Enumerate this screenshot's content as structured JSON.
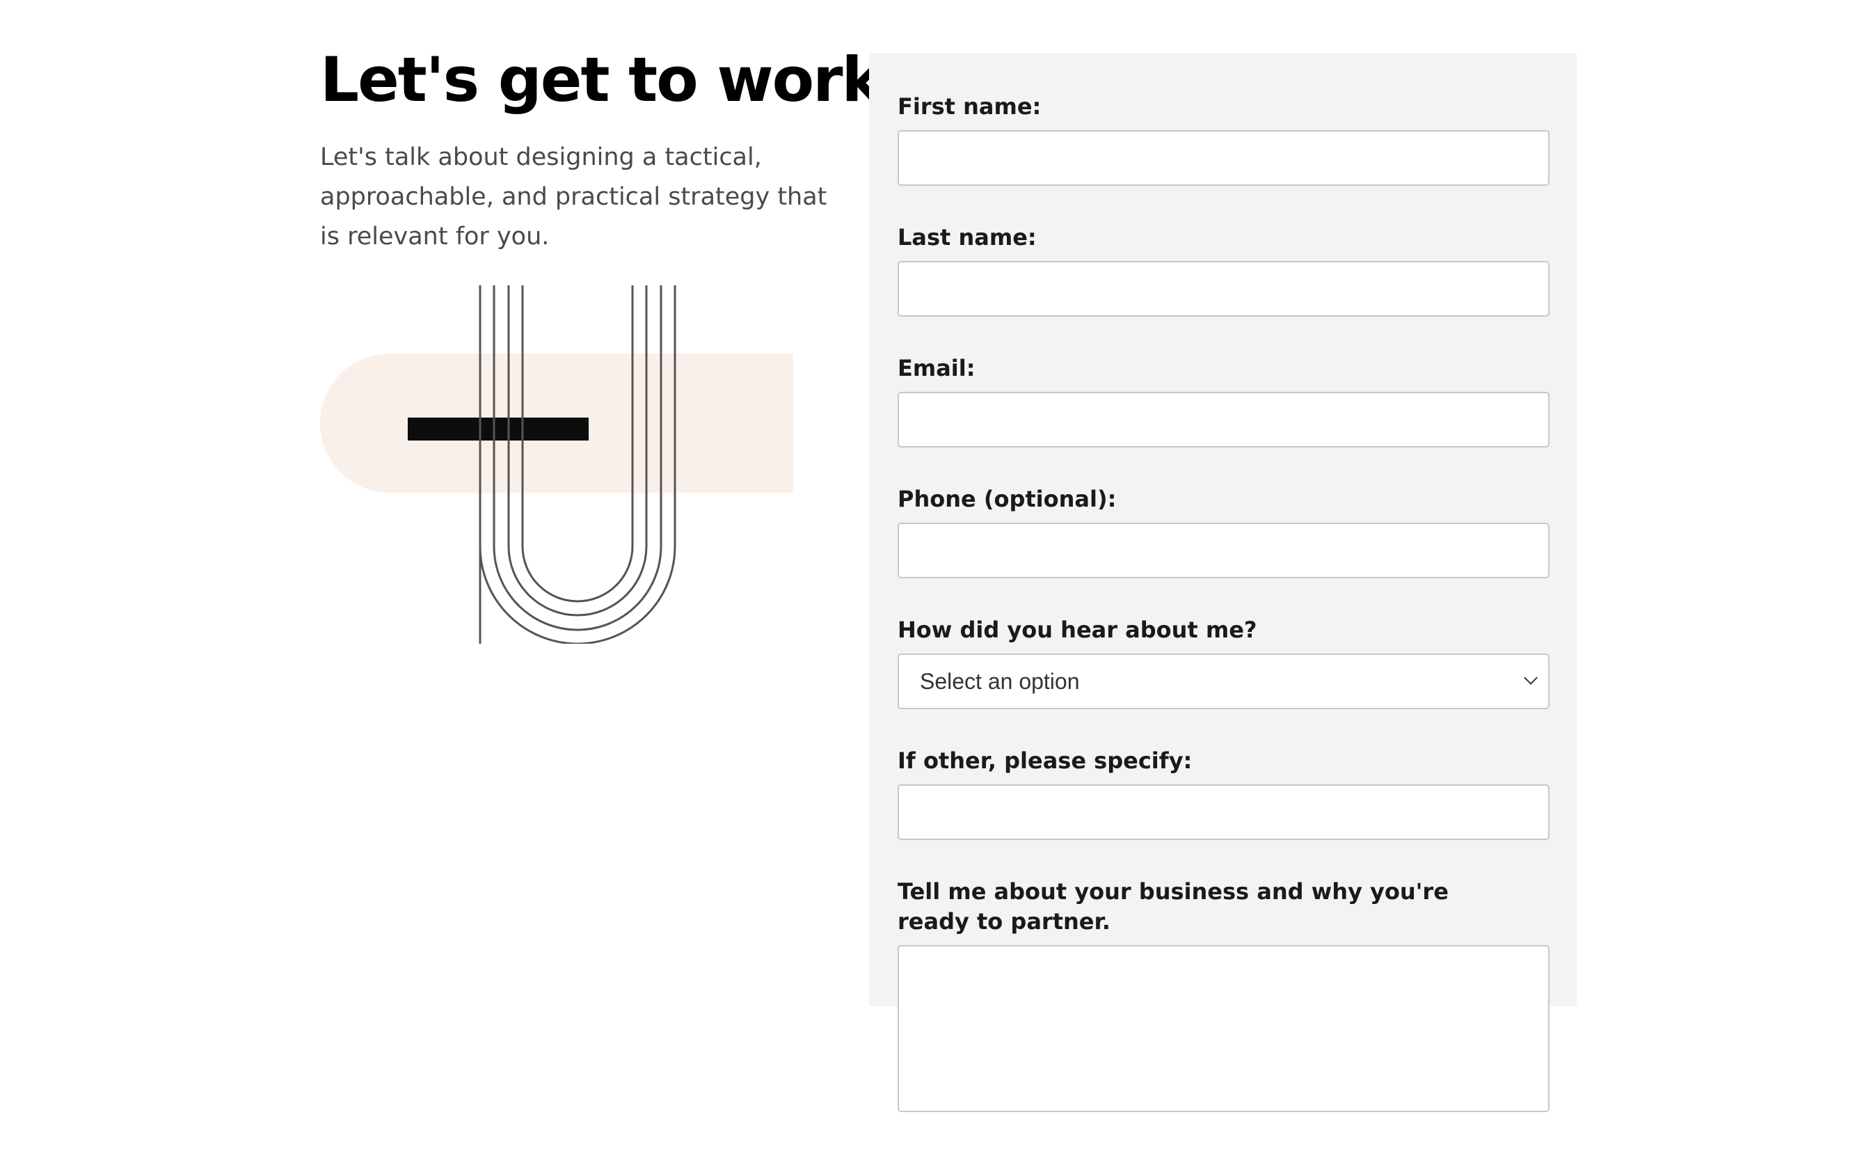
{
  "hero": {
    "title": "Let's get to work!",
    "intro": "Let's talk about designing a tactical, approachable, and practical strategy that is relevant for you."
  },
  "illustration": {
    "icon": "abstract-arches-illustration",
    "accent_color": "#faf0ea",
    "bar_color": "#0d0d0d",
    "line_color": "#555555"
  },
  "form": {
    "first_name": {
      "label": "First name:",
      "value": ""
    },
    "last_name": {
      "label": "Last name:",
      "value": ""
    },
    "email": {
      "label": "Email:",
      "value": ""
    },
    "phone": {
      "label": "Phone (optional):",
      "value": ""
    },
    "source": {
      "label": "How did you hear about me?",
      "selected": "Select an option"
    },
    "other": {
      "label": "If other, please specify:",
      "value": ""
    },
    "message": {
      "label": "Tell me about your business and why you're ready to partner.",
      "value": ""
    }
  },
  "colors": {
    "panel_bg": "#f3f3f3",
    "input_border": "#c8c8c8"
  }
}
